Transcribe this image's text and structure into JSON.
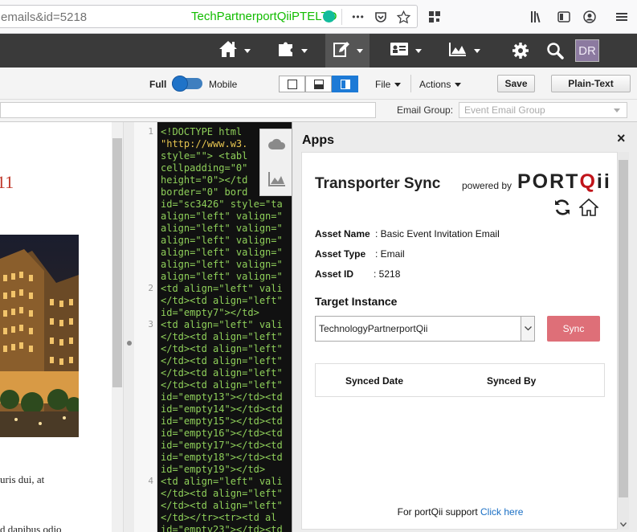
{
  "browser": {
    "url": "emails&id=5218",
    "site_identity": "TechPartnerportQiiPTELTD",
    "overflow_glyph": "•••"
  },
  "nav": {
    "items": [
      "home-icon",
      "puzzle-icon",
      "edit-icon",
      "contact-card-icon",
      "chart-icon"
    ],
    "avatar_initials": "DR"
  },
  "toolbar": {
    "full_label": "Full",
    "mobile_label": "Mobile",
    "file_label": "File",
    "actions_label": "Actions",
    "save_label": "Save",
    "plain_text_label": "Plain-Text"
  },
  "group": {
    "label": "Email Group:",
    "placeholder": "Event Email Group"
  },
  "preview": {
    "heading_fragment": "11",
    "text1": "uris dui, at",
    "text2": "d dapibus odio"
  },
  "code": {
    "line_numbers": [
      "1",
      "2",
      "3",
      "4"
    ],
    "lines": [
      [
        "g",
        "<!DOCTYPE html"
      ],
      [
        "v",
        "\"http://www.w3."
      ],
      [
        "g",
        "style=\"\"> <tabl"
      ],
      [
        "g",
        "cellpadding=\"0\""
      ],
      [
        "g",
        "height=\"0\"></td"
      ],
      [
        "g",
        "border=\"0\" bord"
      ],
      [
        "g",
        "id=\"sc3426\" style=\"ta"
      ],
      [
        "g",
        "align=\"left\" valign=\""
      ],
      [
        "g",
        "align=\"left\" valign=\""
      ],
      [
        "g",
        "align=\"left\" valign=\""
      ],
      [
        "g",
        "align=\"left\" valign=\""
      ],
      [
        "g",
        "align=\"left\" valign=\""
      ],
      [
        "g",
        "align=\"left\" valign=\""
      ],
      [
        "g",
        "<td align=\"left\" vali"
      ],
      [
        "g",
        "</td><td align=\"left\""
      ],
      [
        "g",
        "id=\"empty7\"></td>"
      ],
      [
        "g",
        "<td align=\"left\" vali"
      ],
      [
        "g",
        "</td><td align=\"left\""
      ],
      [
        "g",
        "</td><td align=\"left\""
      ],
      [
        "g",
        "</td><td align=\"left\""
      ],
      [
        "g",
        "</td><td align=\"left\""
      ],
      [
        "g",
        "</td><td align=\"left\""
      ],
      [
        "g",
        "id=\"empty13\"></td><td"
      ],
      [
        "g",
        "id=\"empty14\"></td><td"
      ],
      [
        "g",
        "id=\"empty15\"></td><td"
      ],
      [
        "g",
        "id=\"empty16\"></td><td"
      ],
      [
        "g",
        "id=\"empty17\"></td><td"
      ],
      [
        "g",
        "id=\"empty18\"></td><td"
      ],
      [
        "g",
        "id=\"empty19\"></td>"
      ],
      [
        "g",
        "<td align=\"left\" vali"
      ],
      [
        "g",
        "</td><td align=\"left\""
      ],
      [
        "g",
        "</td><td align=\"left\""
      ],
      [
        "g",
        "</td></tr><tr><td al"
      ],
      [
        "g",
        "id=\"empty23\"></td><td"
      ]
    ]
  },
  "apps": {
    "title": "Apps",
    "close_glyph": "×",
    "app_title": "Transporter Sync",
    "powered_by": "powered by",
    "logo_text_a": "PORT",
    "logo_text_q": "Q",
    "logo_text_b": "ii",
    "asset_name_label": "Asset Name",
    "asset_name_value": ": Basic Event Invitation Email",
    "asset_type_label": "Asset Type",
    "asset_type_value": ": Email",
    "asset_id_label": "Asset ID",
    "asset_id_value": ": 5218",
    "target_instance_label": "Target Instance",
    "target_instance_value": "TechnologyPartnerportQii",
    "sync_label": "Sync",
    "synced_date_header": "Synced Date",
    "synced_by_header": "Synced By",
    "support_text": "For portQii support",
    "support_link": "Click here"
  },
  "colors": {
    "accent": "#1d7ad6",
    "sync_button": "#de6f78",
    "nav_bg": "#3a3a3a",
    "site_identity": "#12bc00"
  }
}
